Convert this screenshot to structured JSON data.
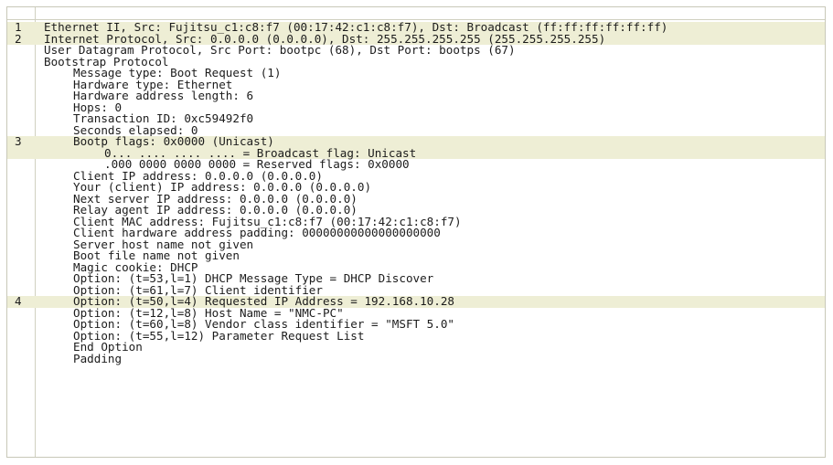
{
  "lines": [
    {
      "num": "1",
      "text": "Ethernet II, Src: Fujitsu_c1:c8:f7 (00:17:42:c1:c8:f7), Dst: Broadcast (ff:ff:ff:ff:ff:ff)"
    },
    {
      "num": "2",
      "text": "Internet Protocol, Src: 0.0.0.0 (0.0.0.0), Dst: 255.255.255.255 (255.255.255.255)"
    },
    {
      "num": "",
      "text": "User Datagram Protocol, Src Port: bootpc (68), Dst Port: bootps (67)"
    },
    {
      "num": "",
      "text": "Bootstrap Protocol"
    },
    {
      "num": "",
      "text": "Message type: Boot Request (1)"
    },
    {
      "num": "",
      "text": "Hardware type: Ethernet"
    },
    {
      "num": "",
      "text": "Hardware address length: 6"
    },
    {
      "num": "",
      "text": "Hops: 0"
    },
    {
      "num": "",
      "text": "Transaction ID: 0xc59492f0"
    },
    {
      "num": "",
      "text": "Seconds elapsed: 0"
    },
    {
      "num": "3",
      "text": "Bootp flags: 0x0000 (Unicast)"
    },
    {
      "num": "",
      "text": "0... .... .... .... = Broadcast flag: Unicast"
    },
    {
      "num": "",
      "text": ".000 0000 0000 0000 = Reserved flags: 0x0000"
    },
    {
      "num": "",
      "text": "Client IP address: 0.0.0.0 (0.0.0.0)"
    },
    {
      "num": "",
      "text": "Your (client) IP address: 0.0.0.0 (0.0.0.0)"
    },
    {
      "num": "",
      "text": "Next server IP address: 0.0.0.0 (0.0.0.0)"
    },
    {
      "num": "",
      "text": "Relay agent IP address: 0.0.0.0 (0.0.0.0)"
    },
    {
      "num": "",
      "text": "Client MAC address: Fujitsu_c1:c8:f7 (00:17:42:c1:c8:f7)"
    },
    {
      "num": "",
      "text": "Client hardware address padding: 00000000000000000000"
    },
    {
      "num": "",
      "text": "Server host name not given"
    },
    {
      "num": "",
      "text": "Boot file name not given"
    },
    {
      "num": "",
      "text": "Magic cookie: DHCP"
    },
    {
      "num": "",
      "text": "Option: (t=53,l=1) DHCP Message Type = DHCP Discover"
    },
    {
      "num": "",
      "text": "Option: (t=61,l=7) Client identifier"
    },
    {
      "num": "4",
      "text": "Option: (t=50,l=4) Requested IP Address = 192.168.10.28"
    },
    {
      "num": "",
      "text": "Option: (t=12,l=8) Host Name = \"NMC-PC\""
    },
    {
      "num": "",
      "text": "Option: (t=60,l=8) Vendor class identifier = \"MSFT 5.0\""
    },
    {
      "num": "",
      "text": "Option: (t=55,l=12) Parameter Request List"
    },
    {
      "num": "",
      "text": "End Option"
    },
    {
      "num": "",
      "text": "Padding"
    }
  ],
  "colors": {
    "highlight": "#eeeed5",
    "border": "#c8c8b8",
    "text": "#1c1c1c"
  }
}
